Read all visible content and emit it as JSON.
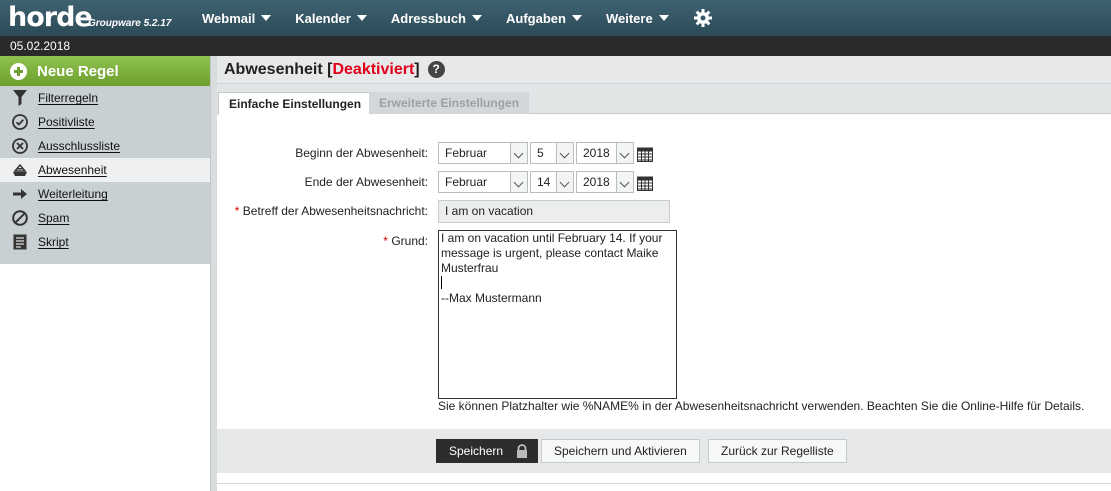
{
  "brand": {
    "name": "horde",
    "version": "Groupware 5.2.17"
  },
  "menu": [
    {
      "label": "Webmail"
    },
    {
      "label": "Kalender"
    },
    {
      "label": "Adressbuch"
    },
    {
      "label": "Aufgaben"
    },
    {
      "label": "Weitere"
    }
  ],
  "date": "05.02.2018",
  "sidebar": {
    "new_rule": "Neue Regel",
    "items": [
      {
        "label": "Filterregeln",
        "icon": "filter-icon"
      },
      {
        "label": "Positivliste",
        "icon": "check-circle-icon"
      },
      {
        "label": "Ausschlussliste",
        "icon": "x-circle-icon"
      },
      {
        "label": "Abwesenheit",
        "icon": "vacation-icon",
        "active": true
      },
      {
        "label": "Weiterleitung",
        "icon": "arrow-right-icon"
      },
      {
        "label": "Spam",
        "icon": "ban-icon"
      },
      {
        "label": "Skript",
        "icon": "script-icon"
      }
    ]
  },
  "header": {
    "title": "Abwesenheit",
    "status": "Deaktiviert",
    "bracket_open": "[",
    "bracket_close": "]",
    "help": "?"
  },
  "tabs": {
    "simple": "Einfache Einstellungen",
    "advanced": "Erweiterte Einstellungen"
  },
  "form": {
    "start": {
      "label": "Beginn der Abwesenheit:",
      "month": "Februar",
      "day": "5",
      "year": "2018"
    },
    "end": {
      "label": "Ende der Abwesenheit:",
      "month": "Februar",
      "day": "14",
      "year": "2018"
    },
    "subject": {
      "label": "Betreff der Abwesenheitsnachricht:",
      "value": "I am on vacation"
    },
    "reason": {
      "label": "Grund:",
      "value_part1": "I am on vacation until February 14. If your\nmessage is urgent, please contact Maike\nMusterfrau\n",
      "value_part2": "\n--Max Mustermann"
    },
    "required_mark": "*",
    "hint": "Sie können Platzhalter wie %NAME% in der Abwesenheitsnachricht verwenden. Beachten Sie die Online-Hilfe für Details."
  },
  "buttons": {
    "save": "Speichern",
    "save_activate": "Speichern und Aktivieren",
    "back": "Zurück zur Regelliste"
  },
  "colors": {
    "topbar": "#35586a",
    "accent_green": "#7cb342",
    "status_red": "#e2001a"
  }
}
